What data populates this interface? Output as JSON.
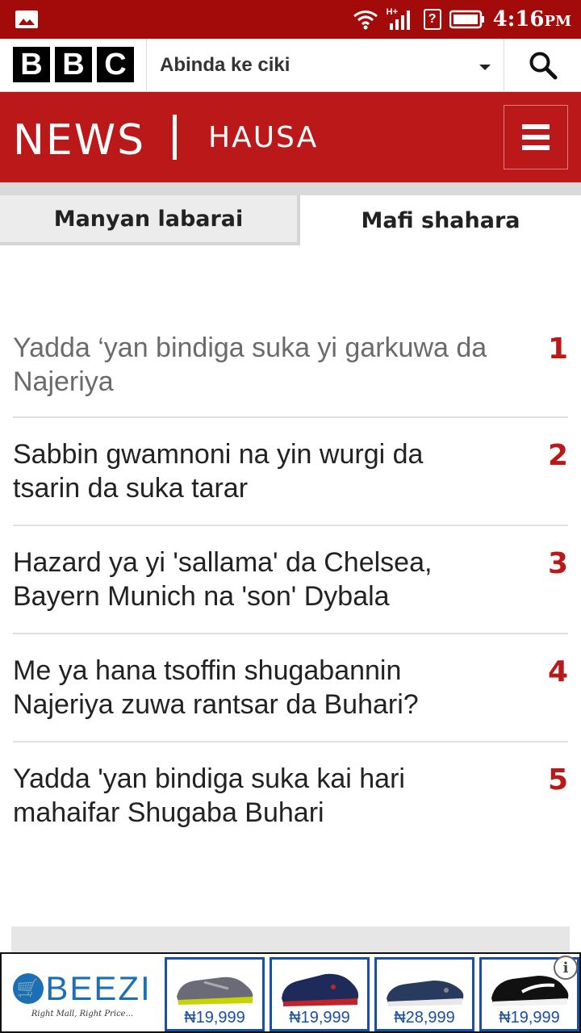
{
  "status_bar": {
    "time": "4:16",
    "time_suffix": "PM",
    "network": "H+",
    "sim_icon": "?"
  },
  "header": {
    "lang_select_label": "Abinda ke ciki",
    "icons": [
      "bbc-logo",
      "search-icon",
      "caret-down-icon"
    ]
  },
  "banner": {
    "news": "NEWS",
    "section": "HAUSA"
  },
  "tabs": [
    {
      "label": "Manyan labarai"
    },
    {
      "label": "Mafi shahara"
    }
  ],
  "popular": [
    {
      "rank": "1",
      "title": "Yadda ‘yan bindiga suka yi garkuwa da Najeriya"
    },
    {
      "rank": "2",
      "title": "Sabbin gwamnoni na yin wurgi da tsarin da suka tarar"
    },
    {
      "rank": "3",
      "title": "Hazard ya yi 'sallama' da Chelsea, Bayern Munich na 'son' Dybala"
    },
    {
      "rank": "4",
      "title": "Me ya hana tsoffin shugabannin Najeriya zuwa rantsar da Buhari?"
    },
    {
      "rank": "5",
      "title": "Yadda 'yan bindiga suka kai hari mahaifar Shugaba Buhari"
    }
  ],
  "ad": {
    "brand": "BEEZI",
    "tagline": "Right Mall, Right Price...",
    "products": [
      {
        "price": "₦19,999"
      },
      {
        "price": "₦19,999"
      },
      {
        "price": "₦28,999"
      },
      {
        "price": "₦19,999"
      }
    ]
  }
}
